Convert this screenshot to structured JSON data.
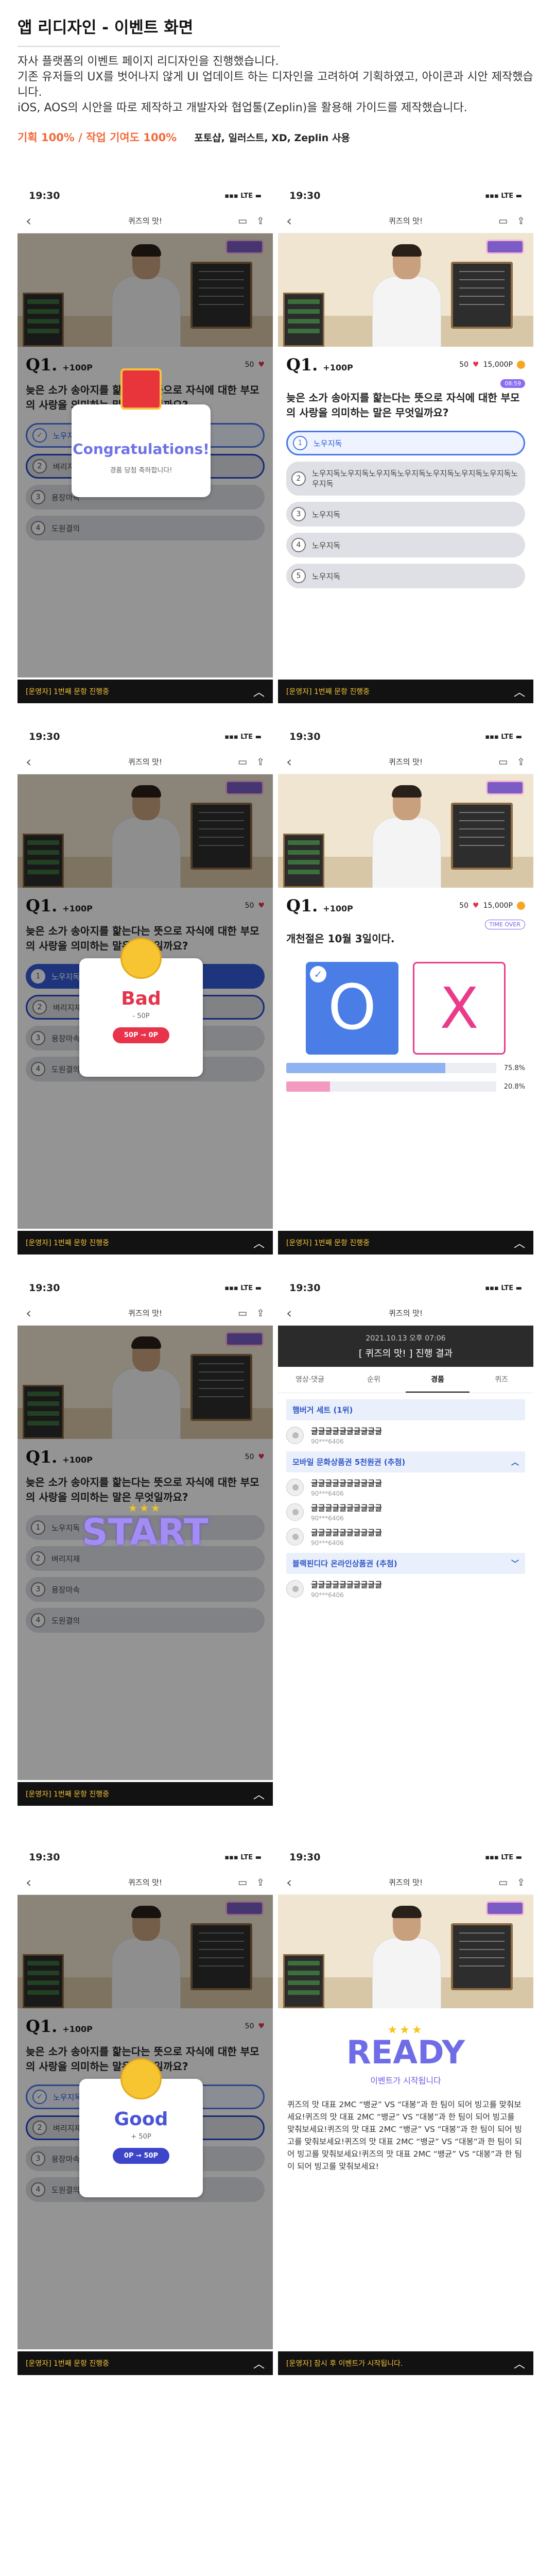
{
  "header": {
    "title": "앱 리디자인 - 이벤트 화면",
    "desc_1": "자사 플랫폼의  이벤트 페이지 리디자인을 진행했습니다.",
    "desc_2": "기존 유저들의 UX를 벗어나지 않게 UI 업데이트 하는 디자인을 고려하여 기획하였고, 아이콘과 시안 제작했습니다.",
    "desc_3": "iOS, AOS의 시안을 따로 제작하고 개발자와 협업툴(Zeplin)을 활용해 가이드를 제작했습니다.",
    "rate": "기획 100% / 작업 기여도 100%",
    "tools": "포토샵, 일러스트, XD, Zeplin 사용"
  },
  "common": {
    "time": "19:30",
    "status": "▪▪▪ LTE ▬",
    "back": "‹",
    "screen_title": "퀴즈의 맛!",
    "chat_icon": "chat-bubble-icon",
    "share_icon": "share-icon",
    "q_num": "Q1.",
    "q_points": "+100P",
    "hearts": "50",
    "points_total": "15,000P",
    "question": "늦은 소가 송아지를 핥는다는 뜻으로 자식에 대한 부모의 사랑을 의미하는 말은 무엇일까요?",
    "bar_left": "[운영자] 1번째 문항 진행중",
    "bar_arrow": "︿",
    "options": [
      "노우지독",
      "벼리지재",
      "용장마속",
      "도원결의"
    ]
  },
  "screen1": {
    "popup_title": "Congratulations!",
    "popup_sub": "경품 당첨 축하합니다!"
  },
  "screen2": {
    "timer": "08:59",
    "options": [
      "노우지독",
      "노우지독노우지독노우지독노우지독노우지독노우지독노우지독노우지독",
      "노우지독",
      "노우지독",
      "노우지독"
    ]
  },
  "screen3": {
    "popup_title": "Bad",
    "popup_sub": "- 50P",
    "popup_pill": "50P → 0P"
  },
  "screen4": {
    "timer": "TIME OVER",
    "question": "개천절은 10월 3일이다.",
    "o_label": "O",
    "x_label": "X",
    "o_pct_label": "75.8%",
    "x_pct_label": "20.8%",
    "o_pct": 75.8,
    "x_pct": 20.8,
    "colors": {
      "o": "#8fb2f2",
      "x": "#f29ac0"
    }
  },
  "screen5": {
    "overlay_word": "START"
  },
  "screen6": {
    "date": "2021.10.13 오후 07:06",
    "result_title": "[ 퀴즈의 맛! ] 진행 결과",
    "tabs": [
      "영상·댓글",
      "순위",
      "경품",
      "퀴즈"
    ],
    "active_tab": "경품",
    "sec1": "햄버거 세트 (1위)",
    "sec2": "모바일 문화상품권 5천원권 (추첨)",
    "sec3": "블랙핀디다 온라인상품권 (추첨)",
    "winner_name": "글글글글글글글글글글",
    "winner_phone": "90***6406"
  },
  "screen7": {
    "popup_title": "Good",
    "popup_sub": "+ 50P",
    "popup_pill": "0P → 50P"
  },
  "screen8": {
    "stars": "★★★",
    "ready": "READY",
    "ready_sub": "이벤트가 시작됩니다",
    "body": "퀴즈의 맛 대표 2MC “뱅균” VS “대봉”과 한 팀이 되어 빙고를 맞춰보세요!퀴즈의 맛 대표 2MC “뱅균” VS “대봉”과 한 팀이 되어 빙고를 맞춰보세요!퀴즈의 맛 대표 2MC “뱅균” VS “대봉”과 한 팀이 되어 빙고를 맞춰보세요!퀴즈의 맛 대표 2MC “뱅균” VS “대봉”과 한 팀이 되어 빙고를 맞춰보세요!퀴즈의 맛 대표 2MC “뱅균” VS “대봉”과 한 팀이 되어 빙고를 맞춰보세요!",
    "bar_left": "[운영자] 잠시 후 이벤트가 시작됩니다."
  }
}
